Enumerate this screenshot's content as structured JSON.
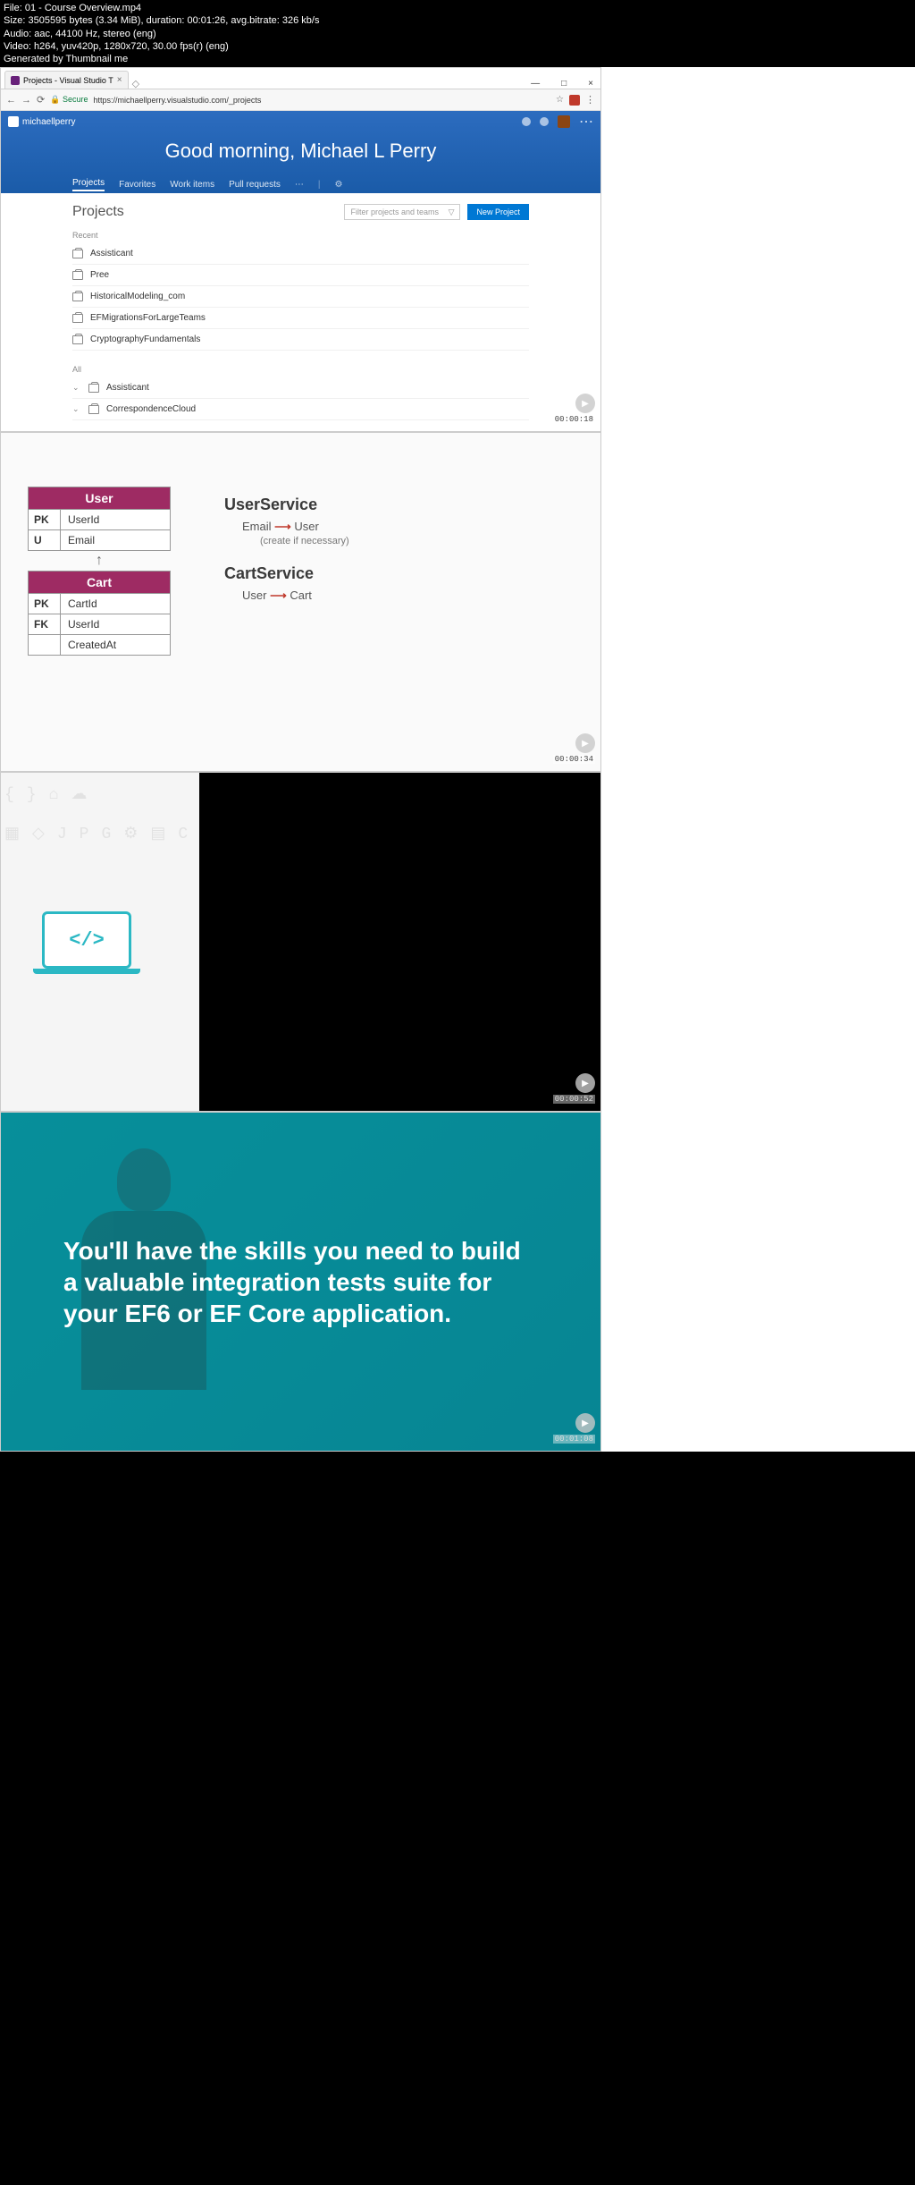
{
  "metadata": {
    "file": "File: 01 - Course Overview.mp4",
    "size": "Size: 3505595 bytes (3.34 MiB), duration: 00:01:26, avg.bitrate: 326 kb/s",
    "audio": "Audio: aac, 44100 Hz, stereo (eng)",
    "video": "Video: h264, yuv420p, 1280x720, 30.00 fps(r) (eng)",
    "generated": "Generated by Thumbnail me"
  },
  "thumb1": {
    "tab_title": "Projects - Visual Studio T",
    "secure_label": "Secure",
    "url": "https://michaellperry.visualstudio.com/_projects",
    "brand": "michaellperry",
    "greeting": "Good morning, Michael L Perry",
    "nav": {
      "projects": "Projects",
      "favorites": "Favorites",
      "work_items": "Work items",
      "pull_requests": "Pull requests"
    },
    "projects_title": "Projects",
    "filter_placeholder": "Filter projects and teams",
    "new_project": "New Project",
    "section_recent": "Recent",
    "recent": {
      "0": "Assisticant",
      "1": "Pree",
      "2": "HistoricalModeling_com",
      "3": "EFMigrationsForLargeTeams",
      "4": "CryptographyFundamentals"
    },
    "section_all": "All",
    "all": {
      "0": "Assisticant",
      "1": "CorrespondenceCloud"
    },
    "timestamp": "00:00:18"
  },
  "thumb2": {
    "user_table": "User",
    "user_pk": "PK",
    "user_pk_col": "UserId",
    "user_u": "U",
    "user_u_col": "Email",
    "cart_table": "Cart",
    "cart_pk": "PK",
    "cart_pk_col": "CartId",
    "cart_fk": "FK",
    "cart_fk_col": "UserId",
    "cart_created": "CreatedAt",
    "userservice": "UserService",
    "userservice_from": "Email",
    "userservice_to": "User",
    "userservice_note": "(create if necessary)",
    "cartservice": "CartService",
    "cartservice_from": "User",
    "cartservice_to": "Cart",
    "timestamp": "00:00:34"
  },
  "thumb3": {
    "code_symbol": "</>",
    "timestamp": "00:00:52"
  },
  "thumb4": {
    "text": "You'll have the skills you need to build a valuable integration tests suite for your EF6 or EF Core application.",
    "timestamp": "00:01:08"
  }
}
